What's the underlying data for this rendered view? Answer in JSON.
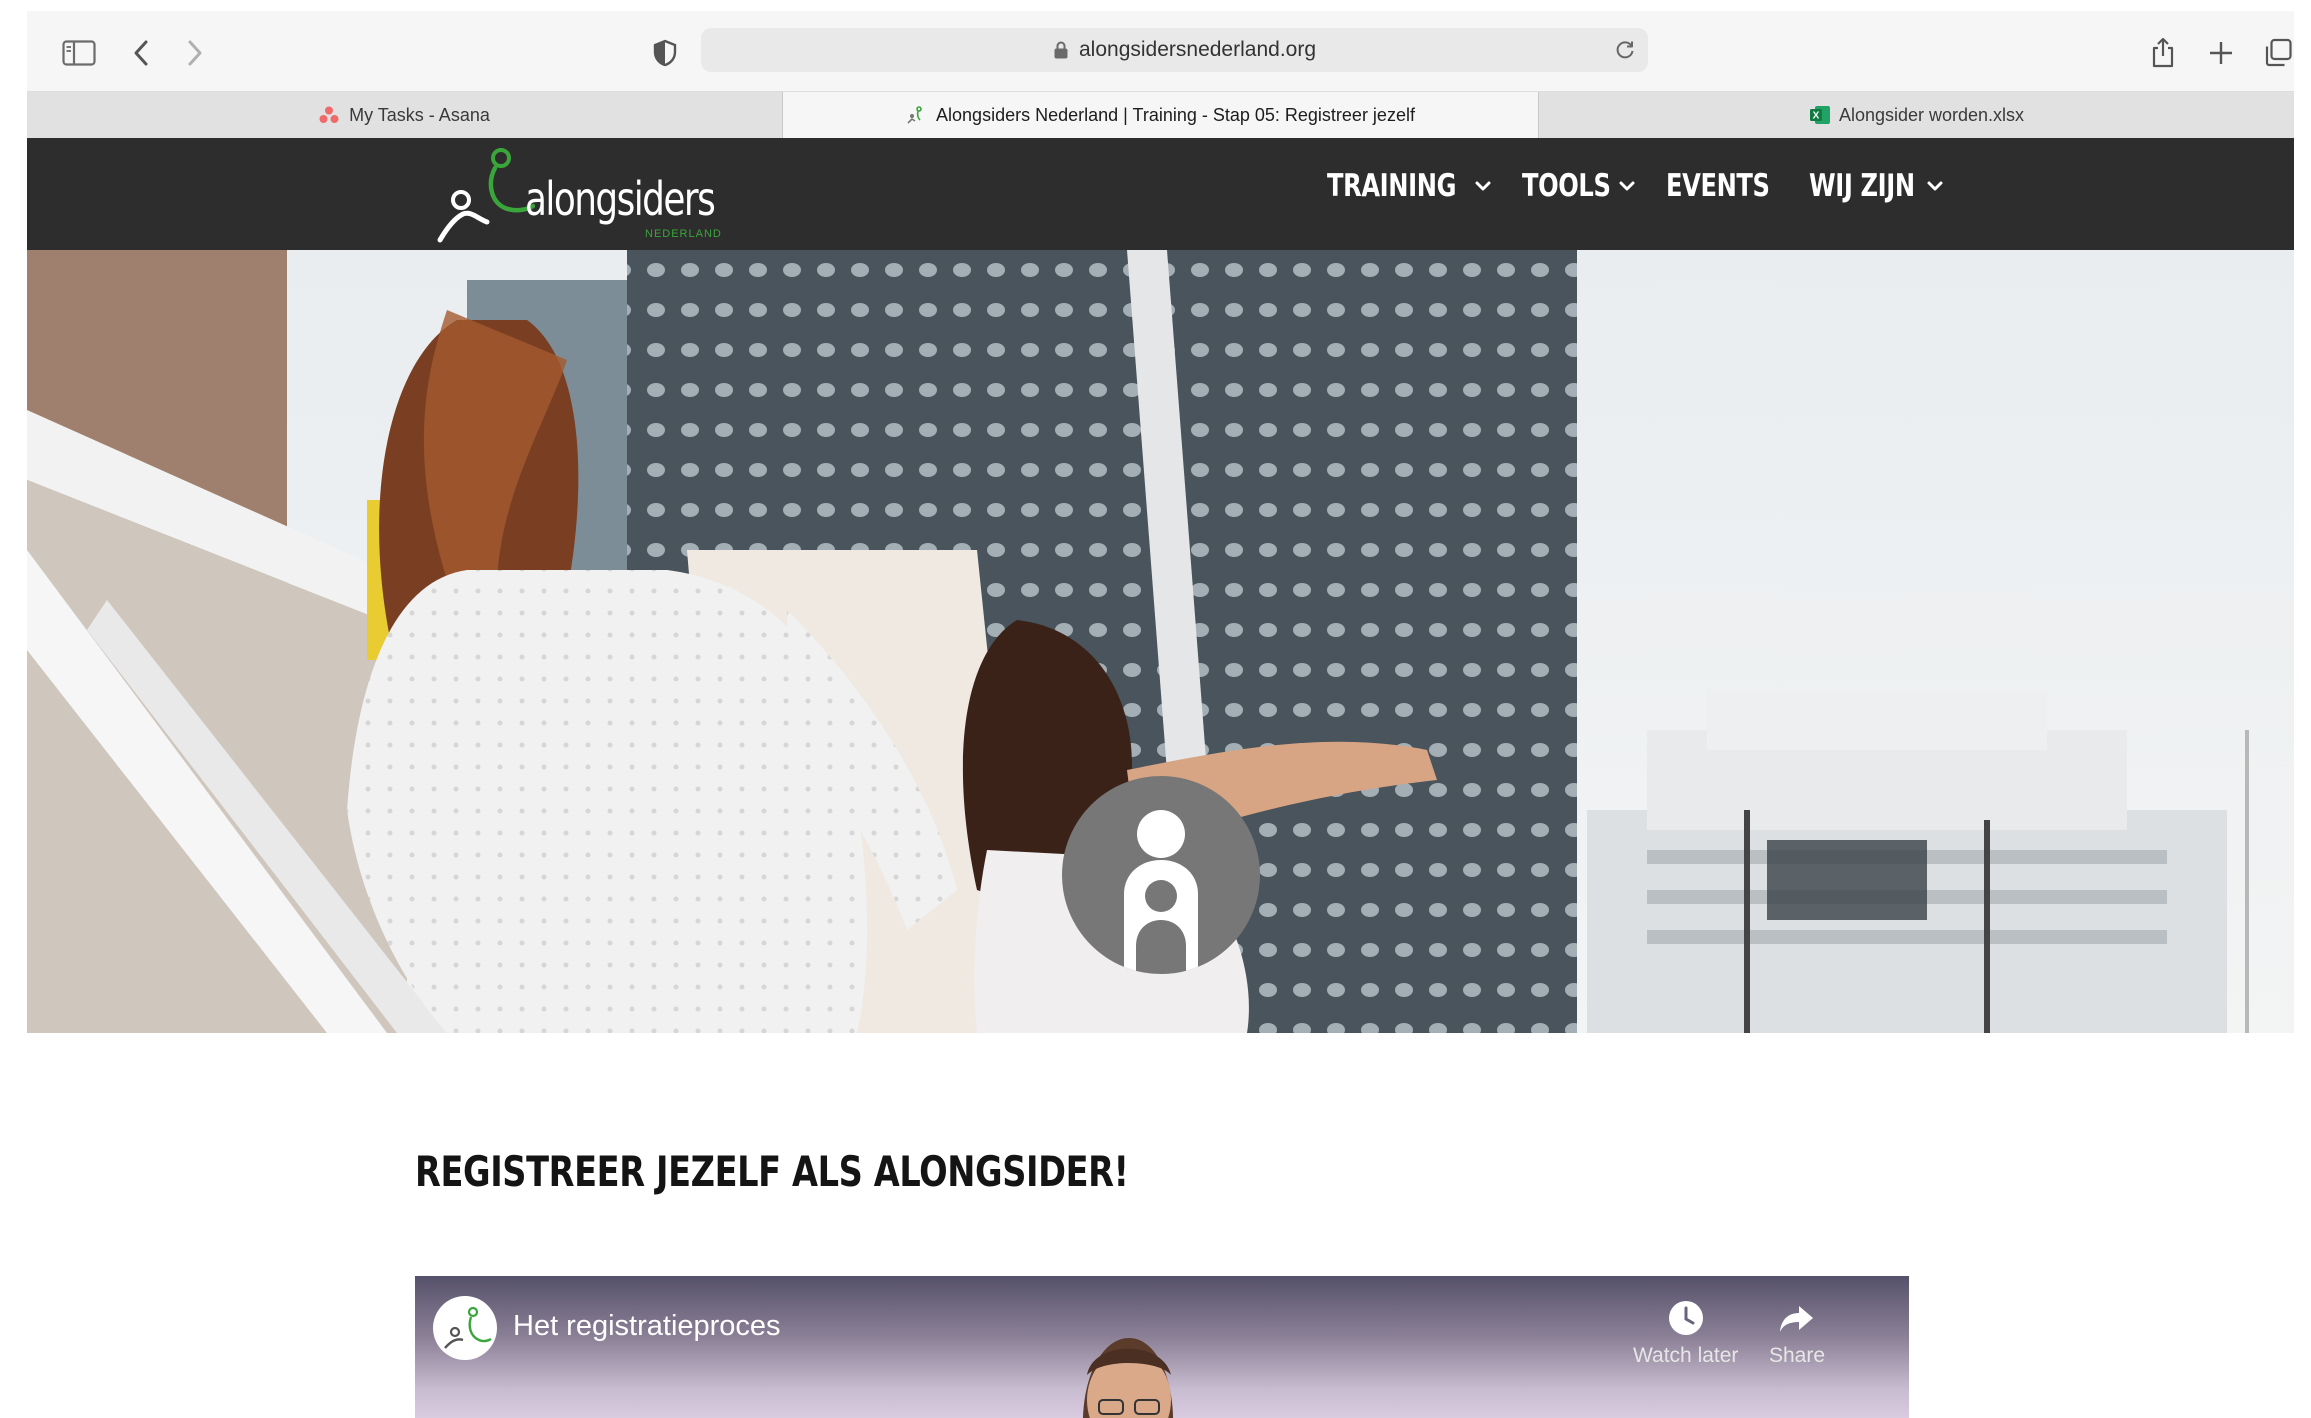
{
  "browser": {
    "url": "alongsidersnederland.org",
    "tabs": [
      {
        "label": "My Tasks - Asana",
        "active": false,
        "icon": "asana-icon"
      },
      {
        "label": "Alongsiders Nederland | Training - Stap 05: Registreer jezelf",
        "active": true,
        "icon": "alongsiders-favicon"
      },
      {
        "label": "Alongsider worden.xlsx",
        "active": false,
        "icon": "excel-icon"
      }
    ]
  },
  "site": {
    "logo_text": "alongsiders",
    "logo_subtext": "NEDERLAND",
    "nav": [
      {
        "label": "TRAINING",
        "has_dropdown": true
      },
      {
        "label": "TOOLS",
        "has_dropdown": true
      },
      {
        "label": "EVENTS",
        "has_dropdown": false
      },
      {
        "label": "WIJ ZIJN",
        "has_dropdown": true
      }
    ]
  },
  "content": {
    "title": "REGISTREER JEZELF ALS ALONGSIDER!",
    "video": {
      "title": "Het registratieproces",
      "watch_later": "Watch later",
      "share": "Share"
    }
  },
  "colors": {
    "header_bg": "#2d2d2d",
    "brand_green": "#3aa53a",
    "avatar_badge": "#777777"
  }
}
